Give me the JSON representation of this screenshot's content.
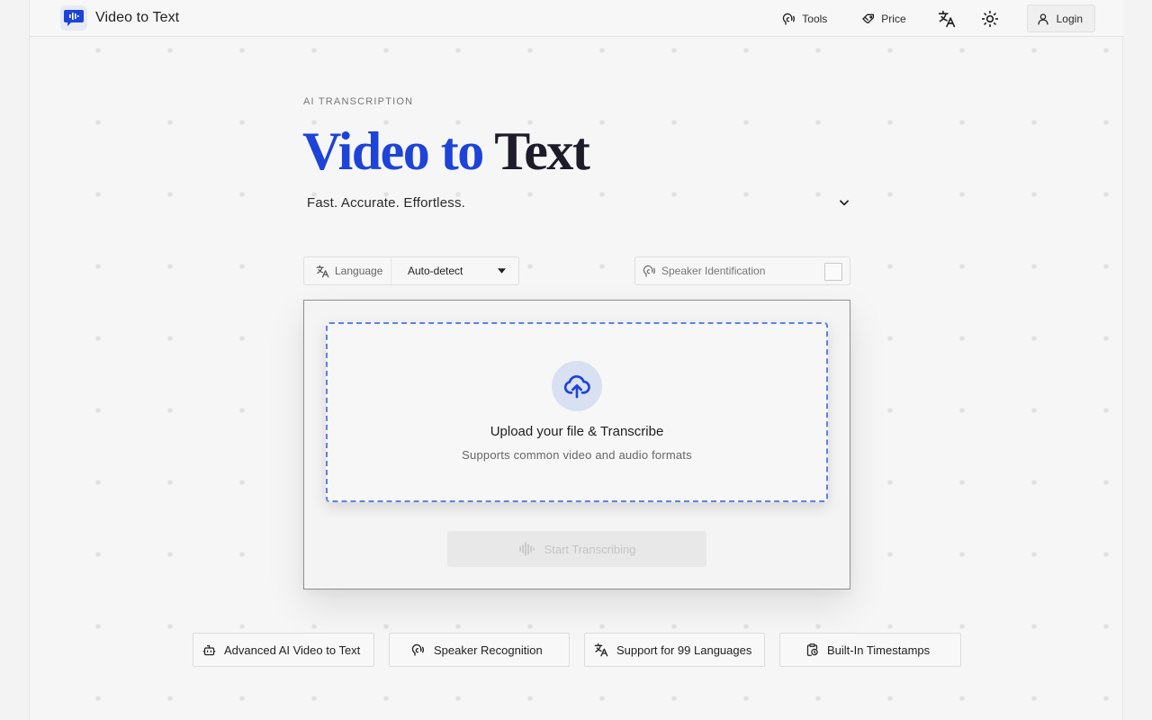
{
  "header": {
    "brand_name": "Video to Text",
    "nav": {
      "tools_label": "Tools",
      "price_label": "Price",
      "login_label": "Login"
    }
  },
  "hero": {
    "eyebrow": "AI TRANSCRIPTION",
    "title_part1": "Video to",
    "title_part2": "Text",
    "tagline": "Fast. Accurate. Effortless."
  },
  "options": {
    "language_label": "Language",
    "language_value": "Auto-detect",
    "speaker_label": "Speaker Identification",
    "speaker_checked": false
  },
  "upload": {
    "title": "Upload your file & Transcribe",
    "subtitle": "Supports common video and audio formats",
    "start_label": "Start Transcribing"
  },
  "features": [
    {
      "label": "Advanced AI Video to Text",
      "icon": "bot-icon"
    },
    {
      "label": "Speaker Recognition",
      "icon": "speaker-icon"
    },
    {
      "label": "Support for 99 Languages",
      "icon": "translate-icon"
    },
    {
      "label": "Built-In Timestamps",
      "icon": "clipboard-clock-icon"
    }
  ],
  "colors": {
    "accent": "#1d43d8",
    "dropzone_border": "#5c82e6",
    "upload_circle": "#d8e0f2"
  }
}
